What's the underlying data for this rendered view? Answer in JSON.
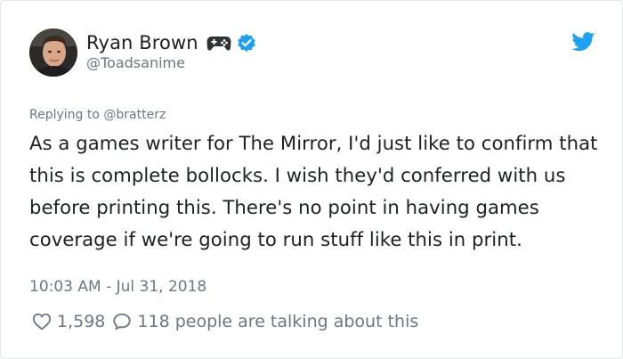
{
  "author": {
    "display_name": "Ryan Brown",
    "handle": "@Toadsanime",
    "emoji_icon": "video-game-controller-icon",
    "verified_icon": "verified-badge-icon"
  },
  "brand": {
    "icon": "twitter-bird-icon",
    "color": "#1da1f2"
  },
  "reply": {
    "prefix": "Replying to ",
    "mention": "@bratterz"
  },
  "tweet": {
    "text": "As a games writer for The Mirror, I'd just like to confirm that this is complete bollocks. I wish they'd conferred with us before printing this. There's no point in having games coverage if we're going to run stuff like this in print.",
    "timestamp": "10:03 AM - Jul 31, 2018"
  },
  "actions": {
    "like_icon": "heart-icon",
    "like_count": "1,598",
    "reply_icon": "speech-bubble-icon",
    "talking_text": "118 people are talking about this"
  },
  "colors": {
    "text_primary": "#1c2022",
    "text_secondary": "#697882",
    "verified_blue": "#1da1f2",
    "border": "#e1e8ed"
  }
}
